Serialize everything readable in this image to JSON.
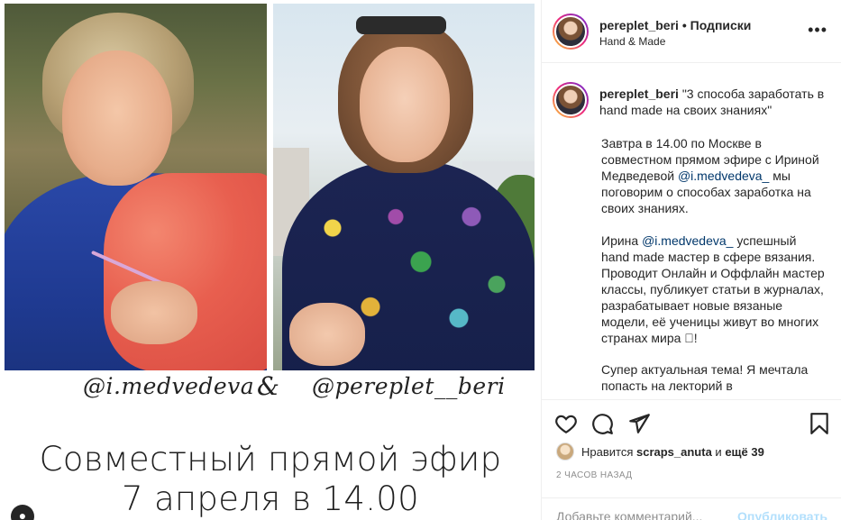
{
  "post_image": {
    "handle_left": "@i.medvedeva",
    "ampersand": "&",
    "handle_right": "@pereplet__beri",
    "announce_line1": "Совместный прямой эфир",
    "announce_line2": "7 апреля в 14.00"
  },
  "header": {
    "username": "pereplet_beri",
    "separator": " • ",
    "follow_status": "Подписки",
    "subtitle": "Hand & Made",
    "more_icon": "more-horizontal-icon"
  },
  "caption": {
    "username": "pereplet_beri",
    "title": "\"3 способа заработать в hand made на своих знаниях\"",
    "p1_before": "Завтра в 14.00 по Москве в совместном прямом эфире с Ириной Медведевой ",
    "p1_mention": "@i.medvedeva_",
    "p1_after": " мы поговорим о способах заработка на своих знаниях.",
    "p2_before": "Ирина ",
    "p2_mention": "@i.medvedeva_",
    "p2_after": " успешный hand made мастер в сфере вязания. Проводит Онлайн и Оффлайн мастер классы, публикует статьи в журналах, разрабатывает новые вязаные модели, её ученицы живут во многих странах мира ⃞!",
    "p3": "Супер актуальная тема! Я мечтала попасть на лекторий в"
  },
  "actions": {
    "like_icon": "heart-icon",
    "comment_icon": "comment-icon",
    "share_icon": "paper-plane-icon",
    "save_icon": "bookmark-icon",
    "likes_prefix": "Нравится ",
    "likes_user": "scraps_anuta",
    "likes_and": " и ",
    "likes_others": "ещё 39",
    "timestamp": "2 часов назад",
    "comment_placeholder": "Добавьте комментарий...",
    "publish_label": "Опубликовать"
  },
  "colors": {
    "text": "#262626",
    "secondary": "#8e8e8e",
    "mention": "#00376b",
    "publish_disabled": "#b2dffc",
    "border": "#efefef"
  }
}
